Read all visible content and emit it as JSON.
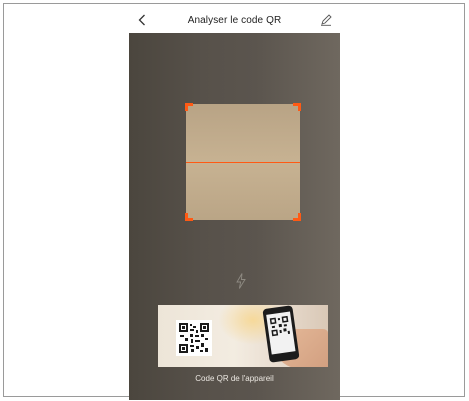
{
  "header": {
    "title": "Analyser le code QR",
    "back_icon": "chevron-left-icon",
    "edit_icon": "pencil-icon"
  },
  "scanner": {
    "corner_color": "#ff5a14",
    "line_color": "#ff5a14"
  },
  "flash": {
    "icon": "lightning-icon"
  },
  "banner": {
    "caption": "Code QR de l'appareil"
  }
}
